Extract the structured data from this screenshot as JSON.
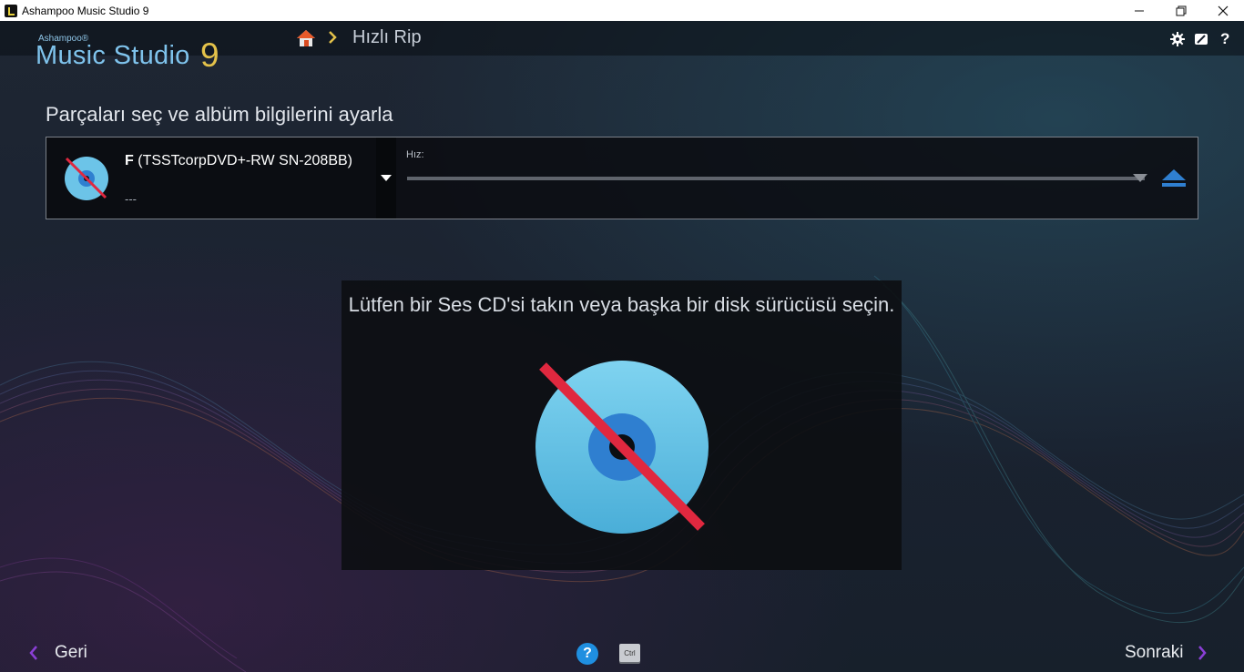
{
  "window": {
    "title": "Ashampoo Music Studio 9",
    "minimize_icon": "minimize-icon",
    "restore_icon": "restore-icon",
    "close_icon": "close-icon"
  },
  "logo": {
    "brand": "Ashampoo®",
    "product": "Music Studio",
    "version": "9"
  },
  "breadcrumb": {
    "home_icon": "home-icon",
    "current": "Hızlı Rip"
  },
  "toolbar": {
    "settings_icon": "gear-icon",
    "feedback_icon": "edit-icon",
    "help_label": "?"
  },
  "main": {
    "heading": "Parçaları seç ve albüm bilgilerini ayarla"
  },
  "drive": {
    "letter": "F",
    "name": "(TSSTcorpDVD+-RW SN-208BB)",
    "status": "---",
    "speed_label": "Hız:"
  },
  "message": {
    "text": "Lütfen bir Ses CD'si takın veya başka bir disk sürücüsü seçin."
  },
  "footer": {
    "back_label": "Geri",
    "next_label": "Sonraki",
    "help_label": "?",
    "ctrl_label": "Ctrl"
  },
  "colors": {
    "accent_blue": "#7fc3ec",
    "accent_yellow": "#e4c24a",
    "nav_arrow": "#8a3fd6",
    "no_disc_red": "#e0283f",
    "disc_blue": "#5bbde4"
  }
}
